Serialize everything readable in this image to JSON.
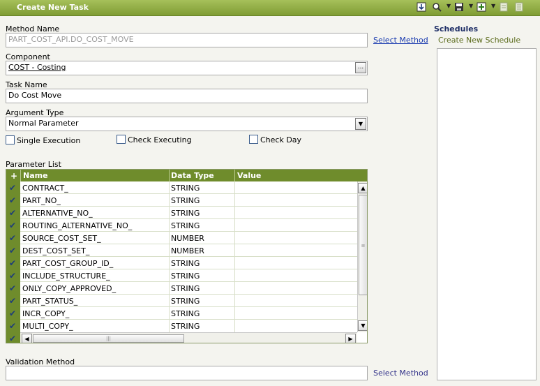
{
  "window": {
    "title": "Create New Task"
  },
  "toolbar": {
    "icons": [
      "download-icon",
      "zoom-icon",
      "save-icon",
      "add-icon",
      "document-icon",
      "list-icon"
    ]
  },
  "form": {
    "method_name": {
      "label": "Method Name",
      "value": "PART_COST_API.DO_COST_MOVE",
      "link": "Select Method"
    },
    "component": {
      "label": "Component",
      "value": "COST - Costing",
      "button": "..."
    },
    "task_name": {
      "label": "Task Name",
      "value": "Do Cost Move"
    },
    "argument_type": {
      "label": "Argument Type",
      "value": "Normal Parameter"
    },
    "checkboxes": {
      "single_execution": "Single Execution",
      "check_executing": "Check Executing",
      "check_day": "Check Day"
    },
    "validation_method": {
      "label": "Validation Method",
      "value": "",
      "link": "Select Method"
    }
  },
  "parameter_list": {
    "label": "Parameter List",
    "add": "+",
    "columns": [
      "Name",
      "Data Type",
      "Value"
    ],
    "rows": [
      {
        "name": "CONTRACT_",
        "type": "STRING",
        "value": ""
      },
      {
        "name": "PART_NO_",
        "type": "STRING",
        "value": ""
      },
      {
        "name": "ALTERNATIVE_NO_",
        "type": "STRING",
        "value": ""
      },
      {
        "name": "ROUTING_ALTERNATIVE_NO_",
        "type": "STRING",
        "value": ""
      },
      {
        "name": "SOURCE_COST_SET_",
        "type": "NUMBER",
        "value": ""
      },
      {
        "name": "DEST_COST_SET_",
        "type": "NUMBER",
        "value": ""
      },
      {
        "name": "PART_COST_GROUP_ID_",
        "type": "STRING",
        "value": ""
      },
      {
        "name": "INCLUDE_STRUCTURE_",
        "type": "STRING",
        "value": ""
      },
      {
        "name": "ONLY_COPY_APPROVED_",
        "type": "STRING",
        "value": ""
      },
      {
        "name": "PART_STATUS_",
        "type": "STRING",
        "value": ""
      },
      {
        "name": "INCR_COPY_",
        "type": "STRING",
        "value": ""
      },
      {
        "name": "MULTI_COPY_",
        "type": "STRING",
        "value": ""
      }
    ]
  },
  "schedules": {
    "title": "Schedules",
    "create_link": "Create New Schedule"
  },
  "colors": {
    "header_green": "#7f9c34",
    "grid_green": "#6f8c2c",
    "link_blue": "#1a3bb0"
  }
}
